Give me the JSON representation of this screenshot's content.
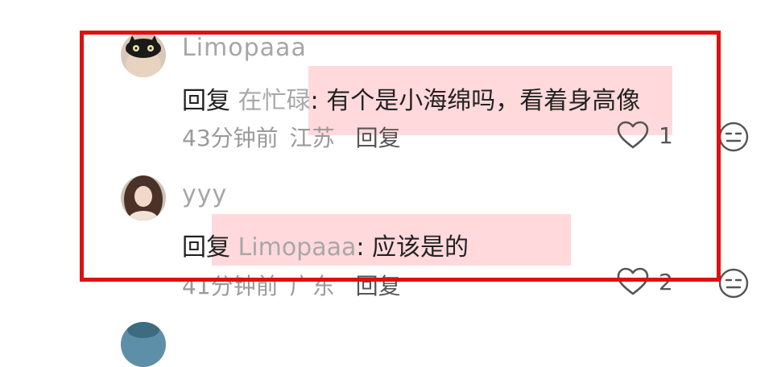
{
  "comments": [
    {
      "username": "Limopaaa",
      "reply_prefix": "回复",
      "reply_target": "在忙碌",
      "text": ": 有个是小海绵吗，看着身高像",
      "time": "43分钟前",
      "location": "江苏",
      "reply_label": "回复",
      "likes": "1"
    },
    {
      "username": "yyy",
      "reply_prefix": "回复",
      "reply_target": "Limopaaa",
      "text": ": 应该是的",
      "time": "41分钟前",
      "location": "广东",
      "reply_label": "回复",
      "likes": "2"
    }
  ],
  "icons": {
    "like": "heart-outline-icon",
    "emotion": "expressionless-face-icon"
  },
  "colors": {
    "annotation_box": "#e01010",
    "highlight": "#ffb0b5"
  }
}
